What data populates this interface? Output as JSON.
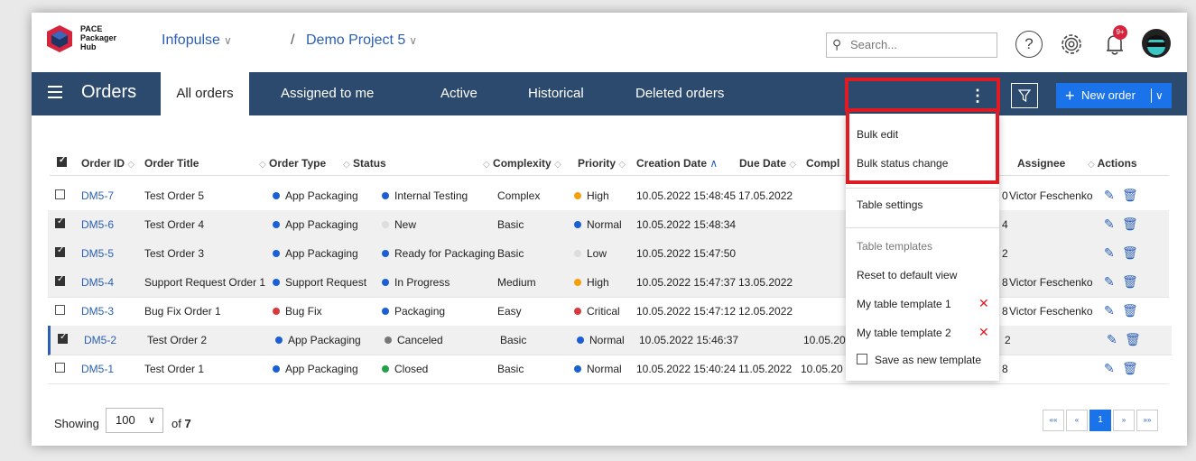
{
  "brand": {
    "line1": "PACE",
    "line2": "Packager",
    "line3": "Hub"
  },
  "breadcrumb": {
    "org": "Infopulse",
    "separator": "/",
    "project": "Demo Project 5"
  },
  "search": {
    "placeholder": "Search..."
  },
  "header": {
    "help": "?",
    "notifications_badge": "9+"
  },
  "nav": {
    "title": "Orders",
    "tabs": [
      "All orders",
      "Assigned to me",
      "Active",
      "Historical",
      "Deleted orders"
    ],
    "active_tab": "All orders",
    "kebab": "⋮",
    "new_order": "New order"
  },
  "table": {
    "columns": [
      "Order ID",
      "Order Title",
      "Order Type",
      "Status",
      "Complexity",
      "Priority",
      "Creation Date",
      "Due Date",
      "Compl",
      "Assignee",
      "Actions"
    ],
    "rows": [
      {
        "checked": false,
        "id": "DM5-7",
        "title": "Test Order 5",
        "type": "App Packaging",
        "type_color": "#1a5fd6",
        "status": "Internal Testing",
        "status_color": "#1a5fd6",
        "complexity": "Complex",
        "priority": "High",
        "priority_color": "#f5a00a",
        "created": "10.05.2022 15:48:45",
        "due": "17.05.2022",
        "completed": "",
        "partial": "0",
        "assignee": "Victor Feschenko"
      },
      {
        "checked": true,
        "id": "DM5-6",
        "title": "Test Order 4",
        "type": "App Packaging",
        "type_color": "#1a5fd6",
        "status": "New",
        "status_color": "#dddddd",
        "complexity": "Basic",
        "priority": "Normal",
        "priority_color": "#1a5fd6",
        "created": "10.05.2022 15:48:34",
        "due": "",
        "completed": "",
        "partial": "4",
        "assignee": ""
      },
      {
        "checked": true,
        "id": "DM5-5",
        "title": "Test Order 3",
        "type": "App Packaging",
        "type_color": "#1a5fd6",
        "status": "Ready for Packaging",
        "status_color": "#1a5fd6",
        "complexity": "Basic",
        "priority": "Low",
        "priority_color": "#dddddd",
        "created": "10.05.2022 15:47:50",
        "due": "",
        "completed": "",
        "partial": "2",
        "assignee": ""
      },
      {
        "checked": true,
        "id": "DM5-4",
        "title": "Support Request Order 1",
        "type": "Support Request",
        "type_color": "#1a5fd6",
        "status": "In Progress",
        "status_color": "#1a5fd6",
        "complexity": "Medium",
        "priority": "High",
        "priority_color": "#f5a00a",
        "created": "10.05.2022 15:47:37",
        "due": "13.05.2022",
        "completed": "",
        "partial": "8",
        "assignee": "Victor Feschenko"
      },
      {
        "checked": false,
        "id": "DM5-3",
        "title": "Bug Fix Order 1",
        "type": "Bug Fix",
        "type_color": "#d63a3a",
        "status": "Packaging",
        "status_color": "#1a5fd6",
        "complexity": "Easy",
        "priority": "Critical",
        "priority_color": "#d63a3a",
        "created": "10.05.2022 15:47:12",
        "due": "12.05.2022",
        "completed": "",
        "partial": "8",
        "assignee": "Victor Feschenko"
      },
      {
        "checked": true,
        "id": "DM5-2",
        "title": "Test Order 2",
        "type": "App Packaging",
        "type_color": "#1a5fd6",
        "status": "Canceled",
        "status_color": "#777777",
        "complexity": "Basic",
        "priority": "Normal",
        "priority_color": "#1a5fd6",
        "created": "10.05.2022 15:46:37",
        "due": "",
        "completed": "10.05.20",
        "partial": "2",
        "assignee": ""
      },
      {
        "checked": false,
        "id": "DM5-1",
        "title": "Test Order 1",
        "type": "App Packaging",
        "type_color": "#1a5fd6",
        "status": "Closed",
        "status_color": "#22a04a",
        "complexity": "Basic",
        "priority": "Normal",
        "priority_color": "#1a5fd6",
        "created": "10.05.2022 15:40:24",
        "due": "11.05.2022",
        "completed": "10.05.20",
        "partial": "8",
        "assignee": ""
      }
    ]
  },
  "menu": {
    "bulk_edit": "Bulk edit",
    "bulk_status": "Bulk status change",
    "table_settings": "Table settings",
    "table_templates": "Table templates",
    "reset": "Reset to default view",
    "template1": "My table template 1",
    "template2": "My table template 2",
    "save_template": "Save as new template"
  },
  "footer": {
    "showing": "Showing",
    "page_size": "100",
    "of_label": "of",
    "total": "7",
    "pager": [
      "««",
      "«",
      "1",
      "»",
      "»»"
    ],
    "current_page": "1"
  },
  "colors": {
    "nav": "#2c4a6e",
    "accent": "#1a73e8",
    "highlight": "#e01b24"
  }
}
